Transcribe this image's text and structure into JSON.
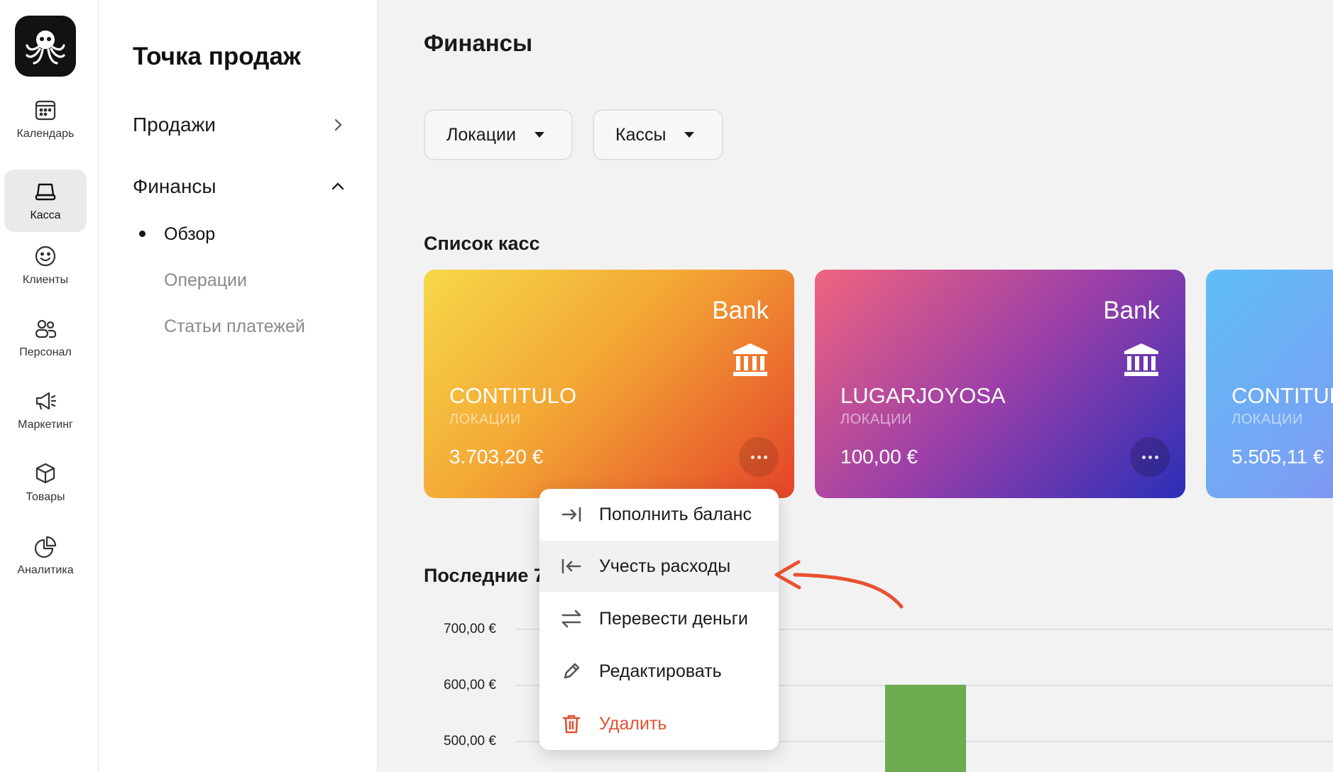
{
  "rail": {
    "items": [
      {
        "label": "Календарь",
        "icon": "calendar-icon"
      },
      {
        "label": "Касса",
        "icon": "register-icon",
        "active": true
      },
      {
        "label": "Клиенты",
        "icon": "smile-icon"
      },
      {
        "label": "Персонал",
        "icon": "staff-icon"
      },
      {
        "label": "Маркетинг",
        "icon": "megaphone-icon"
      },
      {
        "label": "Товары",
        "icon": "box-icon"
      },
      {
        "label": "Аналитика",
        "icon": "pie-chart-icon"
      }
    ]
  },
  "subnav": {
    "title": "Точка продаж",
    "sections": [
      {
        "label": "Продажи",
        "expanded": false
      },
      {
        "label": "Финансы",
        "expanded": true
      }
    ],
    "finance_items": [
      "Обзор",
      "Операции",
      "Статьи платежей"
    ],
    "active_item": "Обзор"
  },
  "main": {
    "title": "Финансы",
    "filters": [
      "Локации",
      "Кассы"
    ],
    "registers_title": "Список касс",
    "recent_title": "Последние 7"
  },
  "cards": [
    {
      "type": "Bank",
      "name": "CONTITULO",
      "location_label": "ЛОКАЦИИ",
      "amount": "3.703,20 €"
    },
    {
      "type": "Bank",
      "name": "LUGARJOYOSA",
      "location_label": "ЛОКАЦИИ",
      "amount": "100,00 €"
    },
    {
      "type": "Bank",
      "name": "CONTITUL",
      "location_label": "ЛОКАЦИИ",
      "amount": "5.505,11 €"
    }
  ],
  "menu": {
    "items": [
      {
        "label": "Пополнить баланс",
        "icon": "arrow-in-icon"
      },
      {
        "label": "Учесть расходы",
        "icon": "arrow-out-icon",
        "hover": true
      },
      {
        "label": "Перевести деньги",
        "icon": "transfer-icon"
      },
      {
        "label": "Редактировать",
        "icon": "pencil-icon"
      },
      {
        "label": "Удалить",
        "icon": "trash-icon",
        "danger": true
      }
    ]
  },
  "chart_data": {
    "type": "bar",
    "y_ticks": [
      "700,00 €",
      "600,00 €",
      "500,00 €"
    ],
    "ylim": [
      500,
      700
    ],
    "values": [
      600
    ]
  },
  "colors": {
    "accent_danger": "#e25233",
    "bar": "#6cab50",
    "annotation_arrow": "#e8512f"
  }
}
